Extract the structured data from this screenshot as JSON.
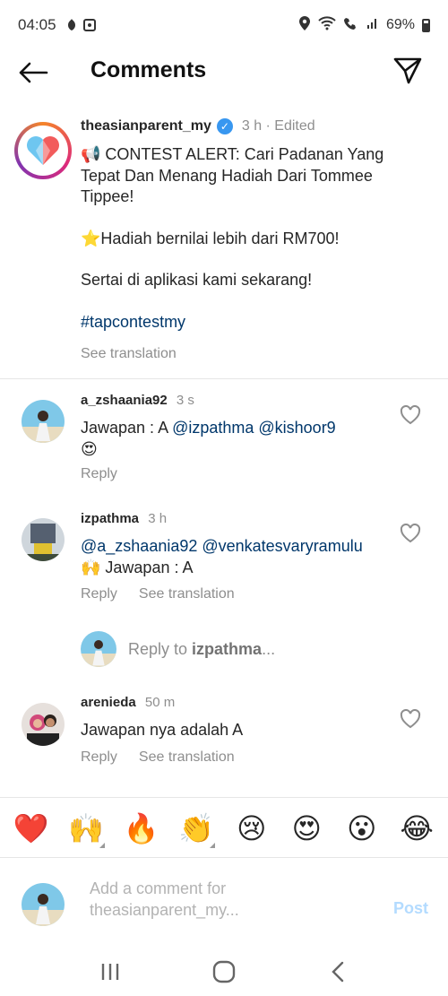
{
  "status_bar": {
    "time": "04:05",
    "battery": "69%",
    "left_icons": [
      "notification-icon",
      "image-icon"
    ],
    "right_icons": [
      "location-icon",
      "wifi-icon",
      "wifi-calling-icon",
      "signal-icon"
    ]
  },
  "header": {
    "title": "Comments"
  },
  "post": {
    "username": "theasianparent_my",
    "time": "3 h · Edited",
    "line1": "📢 CONTEST ALERT: Cari Padanan Yang Tepat Dan Menang Hadiah Dari Tommee Tippee!",
    "line2": "⭐Hadiah bernilai lebih dari RM700!",
    "line3": "Sertai di aplikasi kami sekarang!",
    "hashtag": "#tapcontestmy",
    "see_translation": "See translation"
  },
  "comments": [
    {
      "username": "a_zshaania92",
      "time": "3 s",
      "text_prefix": "Jawapan : A ",
      "mentions": "@izpathma @kishoor9",
      "emoji": "😍",
      "reply": "Reply"
    },
    {
      "username": "izpathma",
      "time": "3 h",
      "mentions": "@a_zshaania92 @venkatesvaryramulu",
      "text": "🙌 Jawapan : A",
      "reply": "Reply",
      "see_translation": "See translation"
    },
    {
      "username": "arenieda",
      "time": "50 m",
      "text": "Jawapan nya adalah A",
      "reply": "Reply",
      "see_translation": "See translation"
    }
  ],
  "reply_to": {
    "prefix": "Reply to ",
    "user": "izpathma",
    "suffix": "..."
  },
  "emoji_bar": [
    "❤️",
    "🙌",
    "🔥",
    "👏",
    "😢",
    "😍",
    "😮",
    "😂"
  ],
  "compose": {
    "placeholder": "Add a comment for theasianparent_my...",
    "post_label": "Post"
  },
  "colors": {
    "mention": "#00376b",
    "verified": "#3897f0",
    "post_button_disabled": "#b3dbff",
    "muted": "#8e8e8e"
  }
}
